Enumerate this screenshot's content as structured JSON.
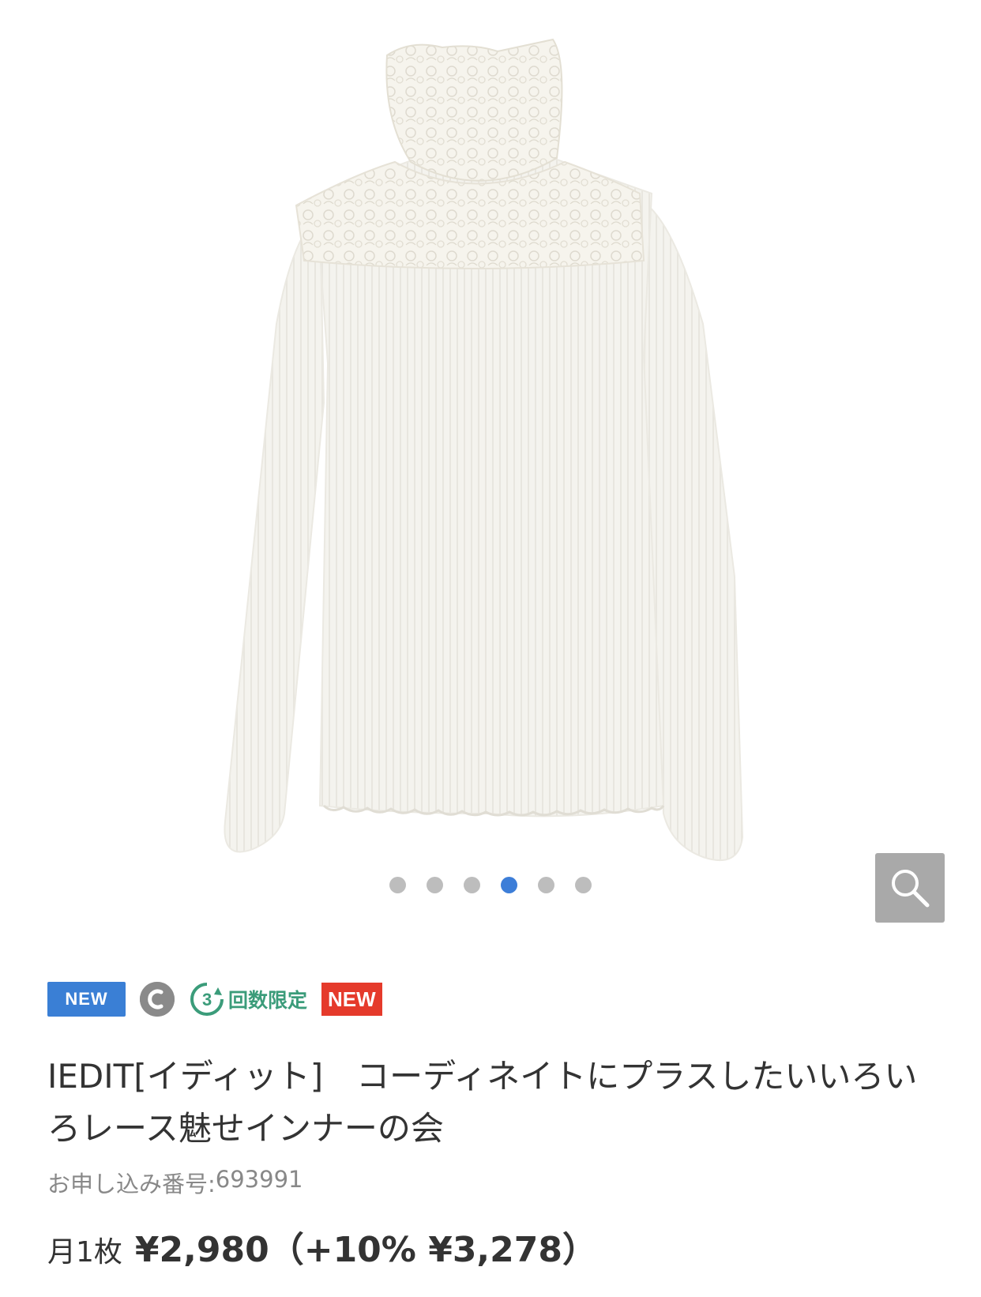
{
  "carousel": {
    "dot_count": 6,
    "active_index": 3
  },
  "badges": {
    "new_blue": "NEW",
    "limit_number": "3",
    "limit_text": "回数限定",
    "new_red": "NEW"
  },
  "product": {
    "title": "IEDIT[イディット]　コーディネイトにプラスしたいいろいろレース魅せインナーの会",
    "order_number_label": "お申し込み番号:",
    "order_number": "693991",
    "price_unit": "月1枚",
    "price": "¥2,980（+10% ¥3,278）"
  },
  "colors": {
    "accent_blue": "#3a7fd5",
    "new_red": "#e53a2b",
    "limit_green": "#3b9c7a"
  },
  "icons": {
    "zoom": "magnifier-icon",
    "c_badge": "c-circle-icon"
  }
}
